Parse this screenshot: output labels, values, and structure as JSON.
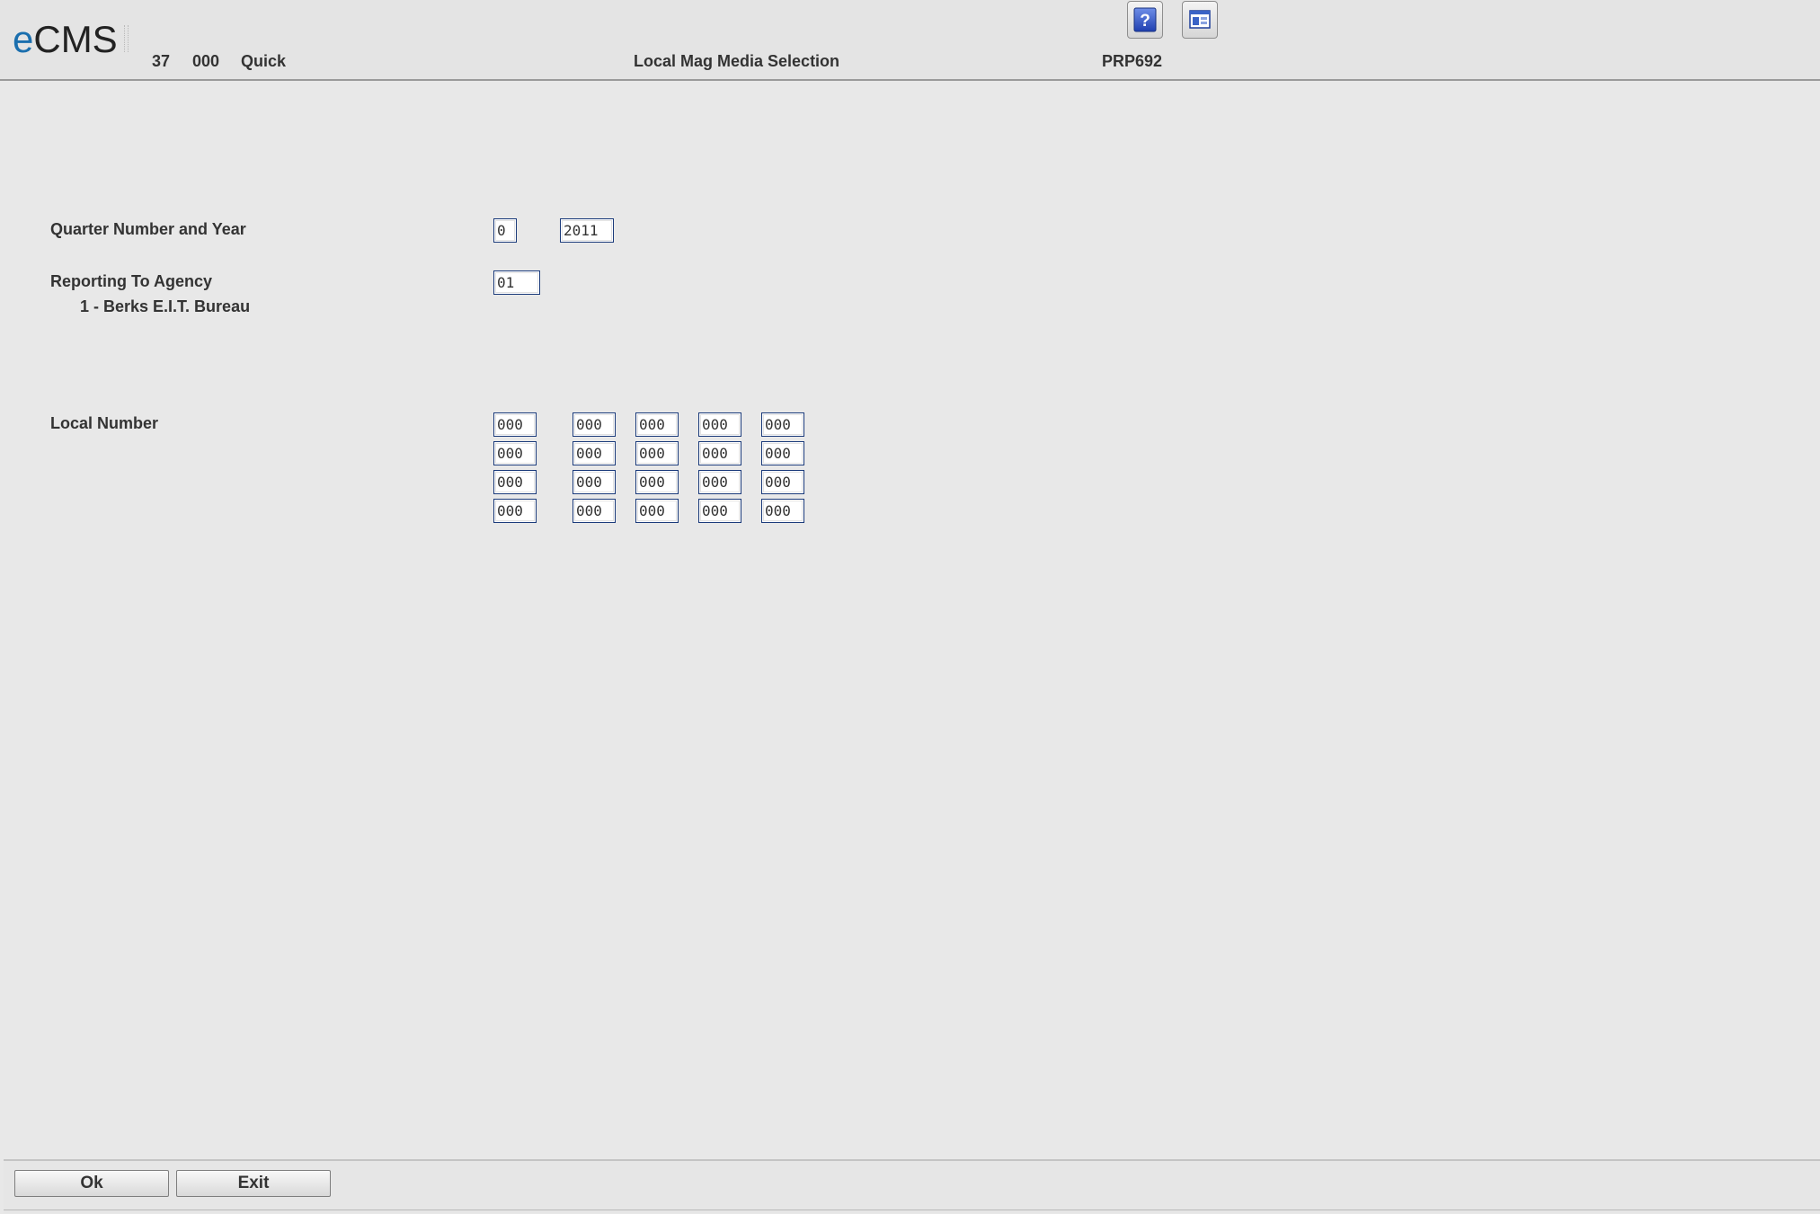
{
  "header": {
    "logo_prefix": "e",
    "logo_suffix": "CMS",
    "company_number": "37",
    "division": "000",
    "mode": "Quick",
    "title": "Local Mag Media Selection",
    "program_id": "PRP692",
    "icons": [
      "help-icon",
      "window-icon"
    ]
  },
  "form": {
    "quarter_label": "Quarter Number and Year",
    "quarter_value": "0",
    "year_value": "2011",
    "agency_label": "Reporting To Agency",
    "agency_value": "01",
    "agency_description": "1 - Berks E.I.T. Bureau",
    "local_label": "Local Number",
    "local_numbers": [
      [
        "000",
        "000",
        "000",
        "000",
        "000"
      ],
      [
        "000",
        "000",
        "000",
        "000",
        "000"
      ],
      [
        "000",
        "000",
        "000",
        "000",
        "000"
      ],
      [
        "000",
        "000",
        "000",
        "000",
        "000"
      ]
    ]
  },
  "footer": {
    "ok_label": "Ok",
    "exit_label": "Exit"
  },
  "colors": {
    "accent": "#1b6fae",
    "field_border": "#1a3a7a",
    "background": "#e8e8e8"
  }
}
